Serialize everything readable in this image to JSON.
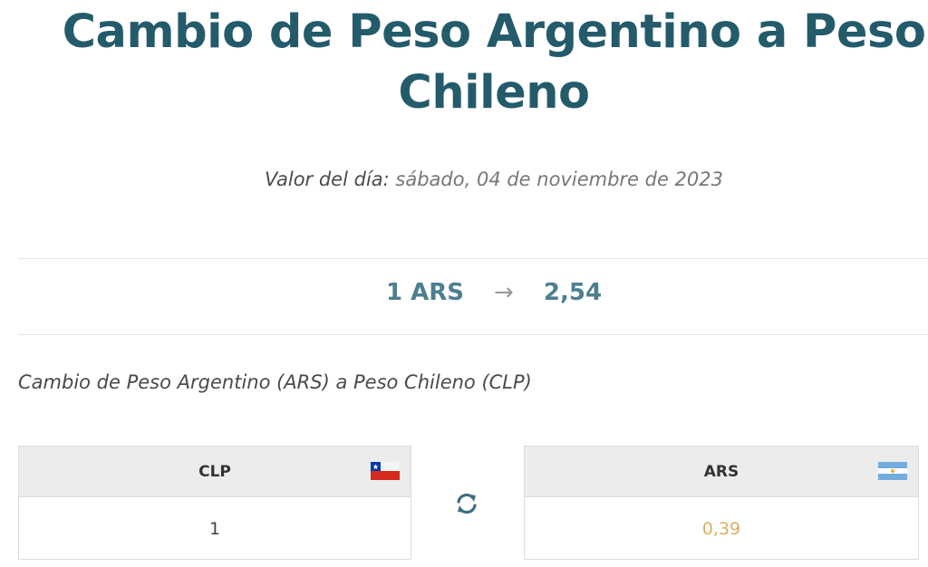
{
  "header": {
    "title": "Cambio de Peso Argentino a Peso Chileno"
  },
  "date": {
    "label": "Valor del día:",
    "value": "sábado, 04 de noviembre de 2023"
  },
  "rate": {
    "from": "1 ARS",
    "arrow": "→",
    "to": "2,54"
  },
  "subtitle": "Cambio de Peso Argentino (ARS) a Peso Chileno (CLP)",
  "converter": {
    "left": {
      "currency": "CLP",
      "flag_icon": "chile-flag-icon",
      "value": "1"
    },
    "swap_icon": "swap-arrows-icon",
    "right": {
      "currency": "ARS",
      "flag_icon": "argentina-flag-icon",
      "value": "0,39"
    }
  },
  "colors": {
    "title": "#245b6b",
    "rate": "#4e7f91",
    "result": "#d8b060",
    "swap_icon": "#3e6f82"
  }
}
